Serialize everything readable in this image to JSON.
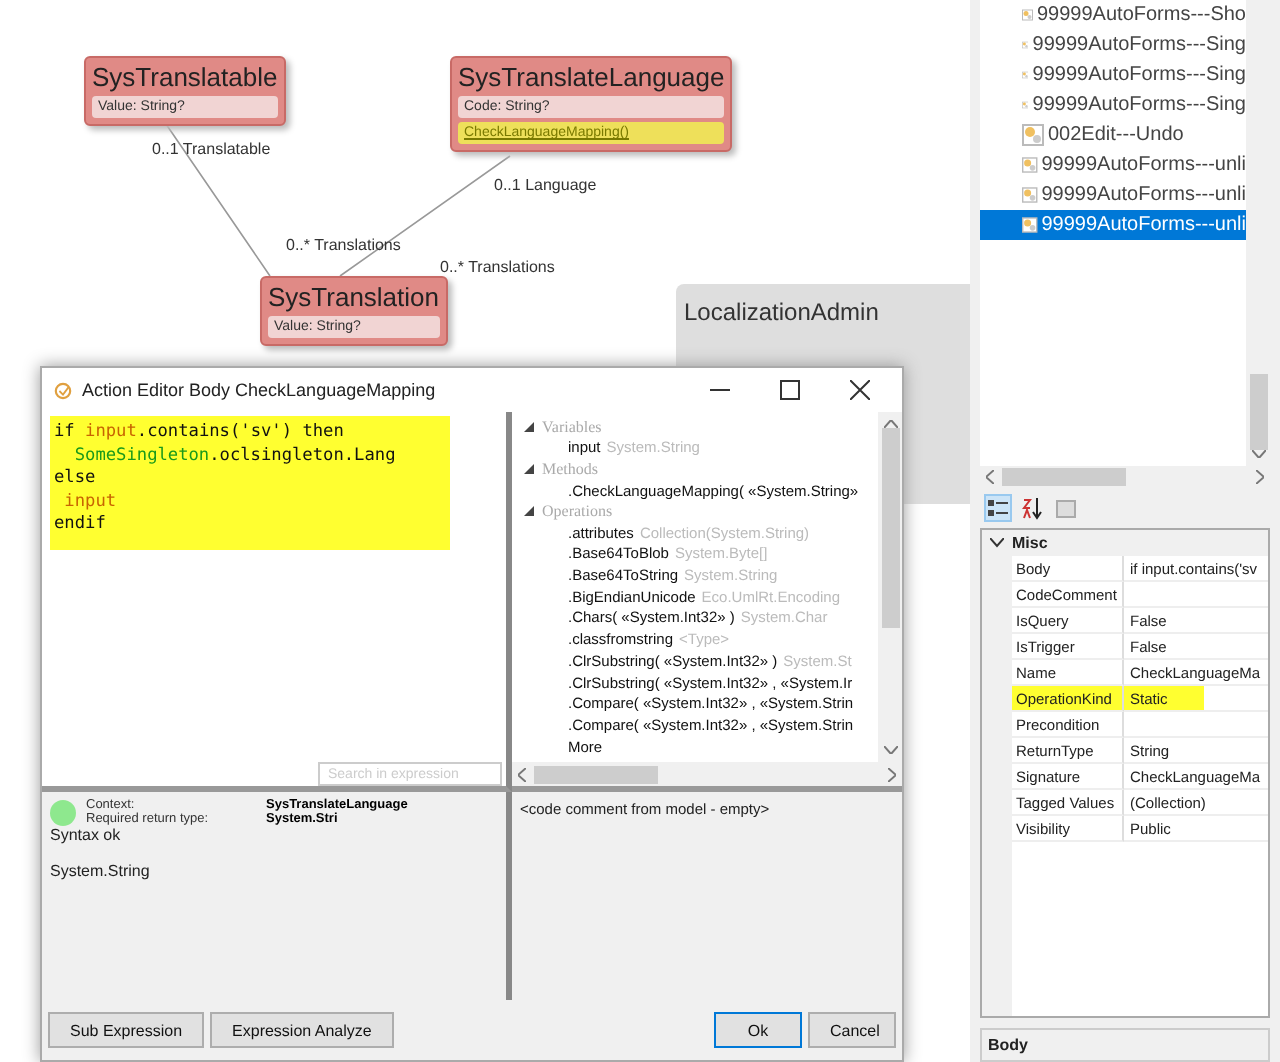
{
  "diagram": {
    "classes": [
      {
        "name": "SysTranslatable",
        "attributes": [
          {
            "text": "Value: String?",
            "highlighted": false
          }
        ]
      },
      {
        "name": "SysTranslateLanguage",
        "attributes": [
          {
            "text": "Code: String?",
            "highlighted": false
          },
          {
            "text": "CheckLanguageMapping()",
            "highlighted": true
          }
        ]
      },
      {
        "name": "SysTranslation",
        "attributes": [
          {
            "text": "Value: String?",
            "highlighted": false
          }
        ]
      }
    ],
    "association_labels": [
      "0..1 Translatable",
      "0..1 Language",
      "0..* Translations",
      "0..* Translations"
    ]
  },
  "background_panel": {
    "title": "LocalizationAdmin"
  },
  "dialog": {
    "title": "Action Editor Body CheckLanguageMapping",
    "code_lines": [
      [
        {
          "kind": "keyword",
          "text": "if "
        },
        {
          "kind": "variable",
          "text": "input"
        },
        {
          "kind": "keyword",
          "text": ".contains('sv') then"
        }
      ],
      [
        {
          "kind": "class",
          "text": "  SomeSingleton"
        },
        {
          "kind": "keyword",
          "text": ".oclsingleton.Lang"
        }
      ],
      [
        {
          "kind": "keyword",
          "text": "else"
        }
      ],
      [
        {
          "kind": "variable",
          "text": " input"
        }
      ],
      [
        {
          "kind": "keyword",
          "text": "endif"
        }
      ]
    ],
    "search": {
      "placeholder": "Search in expression"
    },
    "tree": [
      {
        "label": "Variables",
        "expanded": true,
        "children": [
          {
            "name": "input",
            "type": "System.String"
          }
        ]
      },
      {
        "label": "Methods",
        "expanded": true,
        "children": [
          {
            "name": ".CheckLanguageMapping( «System.String»"
          }
        ]
      },
      {
        "label": "Operations",
        "expanded": true,
        "children": [
          {
            "name": ".attributes",
            "type": "Collection(System.String)"
          },
          {
            "name": ".Base64ToBlob",
            "type": "System.Byte[]"
          },
          {
            "name": ".Base64ToString",
            "type": "System.String"
          },
          {
            "name": ".BigEndianUnicode",
            "type": "Eco.UmlRt.Encoding"
          },
          {
            "name": ".Chars( «System.Int32» )",
            "type": "System.Char"
          },
          {
            "name": ".classfromstring",
            "type": "<Type>"
          },
          {
            "name": ".ClrSubstring( «System.Int32» )",
            "type": "System.St"
          },
          {
            "name": ".ClrSubstring( «System.Int32» ,  «System.Ir"
          },
          {
            "name": ".Compare( «System.Int32» ,  «System.Strin"
          },
          {
            "name": ".Compare( «System.Int32» ,  «System.Strin"
          },
          {
            "name": "More"
          }
        ]
      }
    ],
    "context_label": "Context:",
    "context_value": "SysTranslateLanguage",
    "return_label": "Required return type:",
    "return_value": "System.Stri",
    "syntax_valid": true,
    "syntax_message": "Syntax ok",
    "result_type": "System.String",
    "comment": "<code comment from model - empty>",
    "left_buttons": [
      "Sub Expression",
      "Expression Analyze"
    ],
    "right_buttons": [
      {
        "label": "Ok",
        "default": true
      },
      {
        "label": "Cancel",
        "default": false
      }
    ]
  },
  "form_list": [
    {
      "label": "99999AutoForms---Sho",
      "selected": false
    },
    {
      "label": "99999AutoForms---Sing",
      "selected": false
    },
    {
      "label": "99999AutoForms---Sing",
      "selected": false
    },
    {
      "label": "99999AutoForms---Sing",
      "selected": false
    },
    {
      "label": "002Edit---Undo",
      "selected": false
    },
    {
      "label": "99999AutoForms---unli",
      "selected": false
    },
    {
      "label": "99999AutoForms---unli",
      "selected": false
    },
    {
      "label": "99999AutoForms---unli",
      "selected": true
    }
  ],
  "properties": {
    "category": "Misc",
    "expanded": true,
    "rows": [
      {
        "name": "Body",
        "value": "if input.contains('sv",
        "highlighted": false
      },
      {
        "name": "CodeComment",
        "value": "",
        "highlighted": false
      },
      {
        "name": "IsQuery",
        "value": "False",
        "highlighted": false
      },
      {
        "name": "IsTrigger",
        "value": "False",
        "highlighted": false
      },
      {
        "name": "Name",
        "value": "CheckLanguageMa",
        "highlighted": false
      },
      {
        "name": "OperationKind",
        "value": "Static",
        "highlighted": true
      },
      {
        "name": "Precondition",
        "value": "",
        "highlighted": false
      },
      {
        "name": "ReturnType",
        "value": "String",
        "highlighted": false
      },
      {
        "name": "Signature",
        "value": "CheckLanguageMa",
        "highlighted": false
      },
      {
        "name": "Tagged Values",
        "value": "(Collection)",
        "highlighted": false
      },
      {
        "name": "Visibility",
        "value": "Public",
        "highlighted": false
      }
    ],
    "description_title": "Body"
  }
}
